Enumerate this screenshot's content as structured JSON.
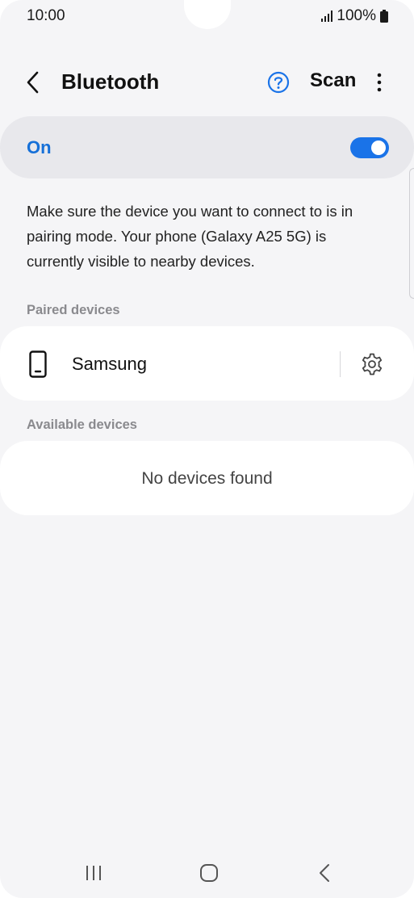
{
  "status_bar": {
    "time": "10:00",
    "battery": "100%",
    "icons": [
      "signal-icon",
      "battery-icon"
    ]
  },
  "header": {
    "title": "Bluetooth",
    "scan_label": "Scan",
    "icons": [
      "back-icon",
      "help-icon",
      "more-icon"
    ]
  },
  "toggle": {
    "label": "On",
    "state": "on",
    "accent_color": "#1a73e8"
  },
  "description": "Make sure the device you want to connect to is in pairing mode. Your phone (Galaxy A25 5G) is currently visible to nearby devices.",
  "paired": {
    "header": "Paired devices",
    "devices": [
      {
        "name": "Samsung",
        "icon": "phone-icon",
        "action_icon": "gear-icon"
      }
    ]
  },
  "available": {
    "header": "Available devices",
    "empty_text": "No devices found"
  },
  "nav_bar": {
    "icons": [
      "recents-icon",
      "home-icon",
      "back-icon"
    ]
  }
}
